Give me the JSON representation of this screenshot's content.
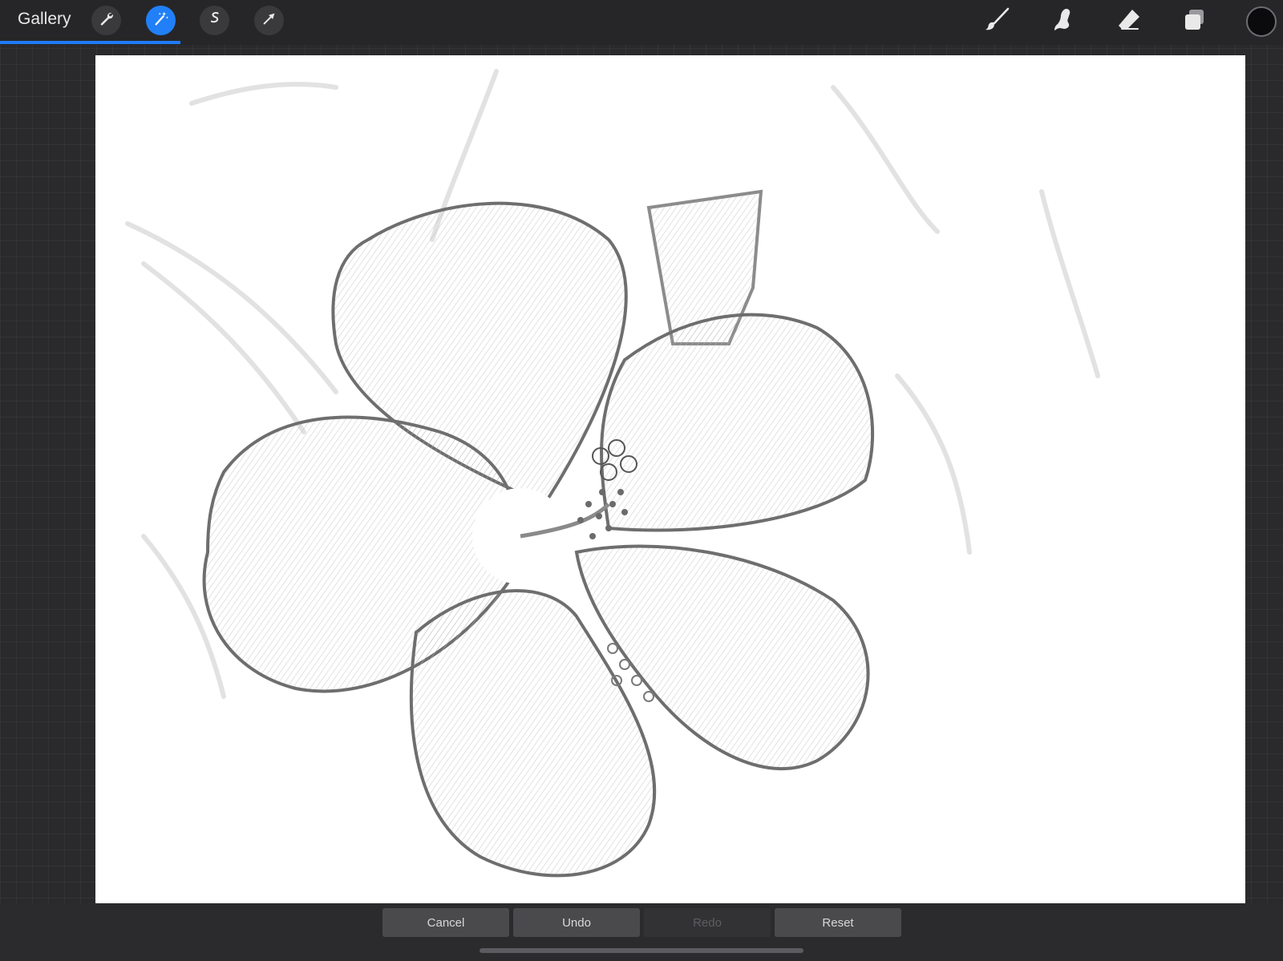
{
  "topbar": {
    "gallery_label": "Gallery",
    "left_tools": [
      "wrench-icon",
      "magic-wand-icon",
      "selection-icon",
      "transform-arrow-icon"
    ],
    "active_tool": "magic-wand-icon",
    "right_tools": [
      "brush-icon",
      "smudge-icon",
      "eraser-icon",
      "layers-icon"
    ],
    "current_color": "#0b0b0d",
    "accent_color": "#2180f7"
  },
  "canvas": {
    "content": "pencil-sketch hibiscus flower"
  },
  "bottom_bar": {
    "cancel_label": "Cancel",
    "undo_label": "Undo",
    "redo_label": "Redo",
    "reset_label": "Reset"
  }
}
